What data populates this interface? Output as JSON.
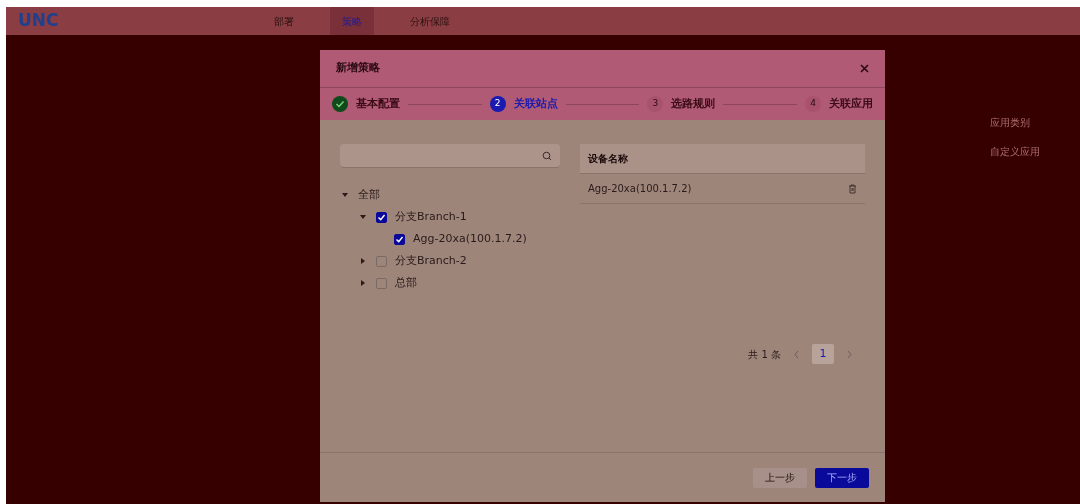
{
  "logo": {
    "text": "UNC"
  },
  "nav": [
    {
      "label": "部署",
      "selected": false
    },
    {
      "label": "策略",
      "selected": true
    },
    {
      "label": "分析保障",
      "selected": false
    }
  ],
  "background_menu": [
    {
      "label": "应用类别"
    },
    {
      "label": "自定义应用"
    }
  ],
  "dialog": {
    "title": "新增策略",
    "steps": [
      {
        "label": "基本配置",
        "done": true,
        "selected": false
      },
      {
        "number": "2",
        "label": "关联站点",
        "done": false,
        "selected": true
      },
      {
        "number": "3",
        "label": "选路规则",
        "done": false,
        "selected": false
      },
      {
        "number": "4",
        "label": "关联应用",
        "done": false,
        "selected": false
      }
    ],
    "tree": [
      {
        "label": "全部",
        "expanded": true,
        "children": [
          {
            "label": "分支Branch-1",
            "expanded": true,
            "checked": true,
            "children": [
              {
                "label": "Agg-20xa(100.1.7.2)",
                "checked": true
              }
            ]
          },
          {
            "label": "分支Branch-2",
            "expanded": false,
            "checked": false
          },
          {
            "label": "总部",
            "expanded": false,
            "checked": false
          }
        ]
      }
    ],
    "table": {
      "columns": [
        "设备名称"
      ],
      "rows": [
        [
          "Agg-20xa(100.1.7.2)"
        ]
      ]
    },
    "pagination": {
      "total": "共 1 条",
      "pages": [
        {
          "label": "1",
          "selected": true
        }
      ]
    },
    "buttons": [
      {
        "label": "上一步",
        "kind": "secondary"
      },
      {
        "label": "下一步",
        "kind": "primary"
      }
    ]
  }
}
